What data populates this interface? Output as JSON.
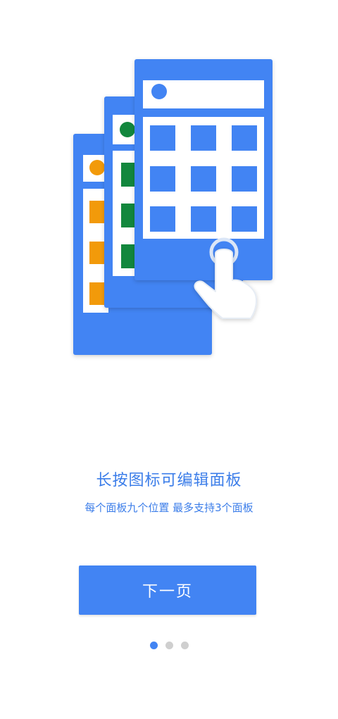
{
  "onboarding": {
    "title": "长按图标可编辑面板",
    "subtitle": "每个面板九个位置 最多支持3个面板",
    "next_button_label": "下一页",
    "page_count": 3,
    "current_page": 1
  },
  "illustration": {
    "icon": "panels-long-press-illustration",
    "colors": {
      "panel_blue": "#4284f3",
      "orange": "#f29a0a",
      "green": "#12873d",
      "white": "#ffffff"
    }
  }
}
